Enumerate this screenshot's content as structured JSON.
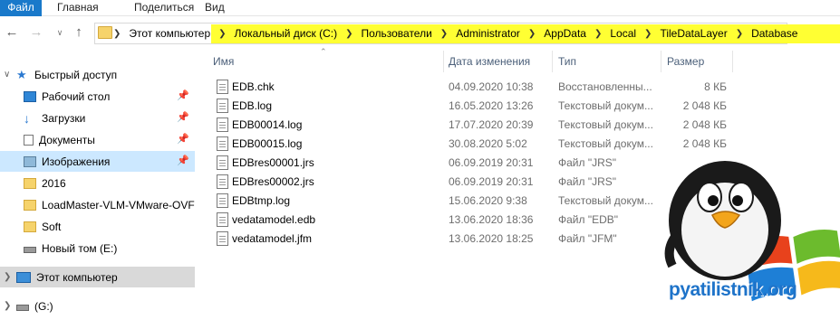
{
  "ribbon": {
    "tabs": [
      "Файл",
      "Главная",
      "Поделиться",
      "Вид"
    ]
  },
  "address": {
    "crumbs": [
      "Этот компьютер",
      "Локальный диск (C:)",
      "Пользователи",
      "Administrator",
      "AppData",
      "Local",
      "TileDataLayer",
      "Database"
    ],
    "highlight_color": "#ffff33"
  },
  "nav": {
    "quick_access": "Быстрый доступ",
    "items": [
      {
        "label": "Рабочий стол",
        "icon": "desktop-icon",
        "pinned": true
      },
      {
        "label": "Загрузки",
        "icon": "download-icon",
        "pinned": true
      },
      {
        "label": "Документы",
        "icon": "documents-icon",
        "pinned": true
      },
      {
        "label": "Изображения",
        "icon": "pictures-icon",
        "pinned": true
      },
      {
        "label": "2016",
        "icon": "folder-icon",
        "pinned": false
      },
      {
        "label": "LoadMaster-VLM-VMware-OVF",
        "icon": "folder-icon",
        "pinned": false
      },
      {
        "label": "Soft",
        "icon": "folder-icon",
        "pinned": false
      },
      {
        "label": "Новый том (E:)",
        "icon": "drive-icon",
        "pinned": false
      }
    ],
    "this_pc": "Этот компьютер",
    "drive_g": "(G:)"
  },
  "columns": {
    "name": "Имя",
    "date": "Дата изменения",
    "type": "Тип",
    "size": "Размер"
  },
  "files": [
    {
      "name": "EDB.chk",
      "date": "04.09.2020 10:38",
      "type": "Восстановленны...",
      "size": "8 КБ"
    },
    {
      "name": "EDB.log",
      "date": "16.05.2020 13:26",
      "type": "Текстовый докум...",
      "size": "2 048 КБ"
    },
    {
      "name": "EDB00014.log",
      "date": "17.07.2020 20:39",
      "type": "Текстовый докум...",
      "size": "2 048 КБ"
    },
    {
      "name": "EDB00015.log",
      "date": "30.08.2020 5:02",
      "type": "Текстовый докум...",
      "size": "2 048 КБ"
    },
    {
      "name": "EDBres00001.jrs",
      "date": "06.09.2019 20:31",
      "type": "Файл \"JRS\"",
      "size": ""
    },
    {
      "name": "EDBres00002.jrs",
      "date": "06.09.2019 20:31",
      "type": "Файл \"JRS\"",
      "size": ""
    },
    {
      "name": "EDBtmp.log",
      "date": "15.06.2020 9:38",
      "type": "Текстовый докум...",
      "size": ""
    },
    {
      "name": "vedatamodel.edb",
      "date": "13.06.2020 18:36",
      "type": "Файл \"EDB\"",
      "size": ""
    },
    {
      "name": "vedatamodel.jfm",
      "date": "13.06.2020 18:25",
      "type": "Файл \"JFM\"",
      "size": ""
    }
  ],
  "watermark": {
    "text": "pyatilistnik.org"
  }
}
